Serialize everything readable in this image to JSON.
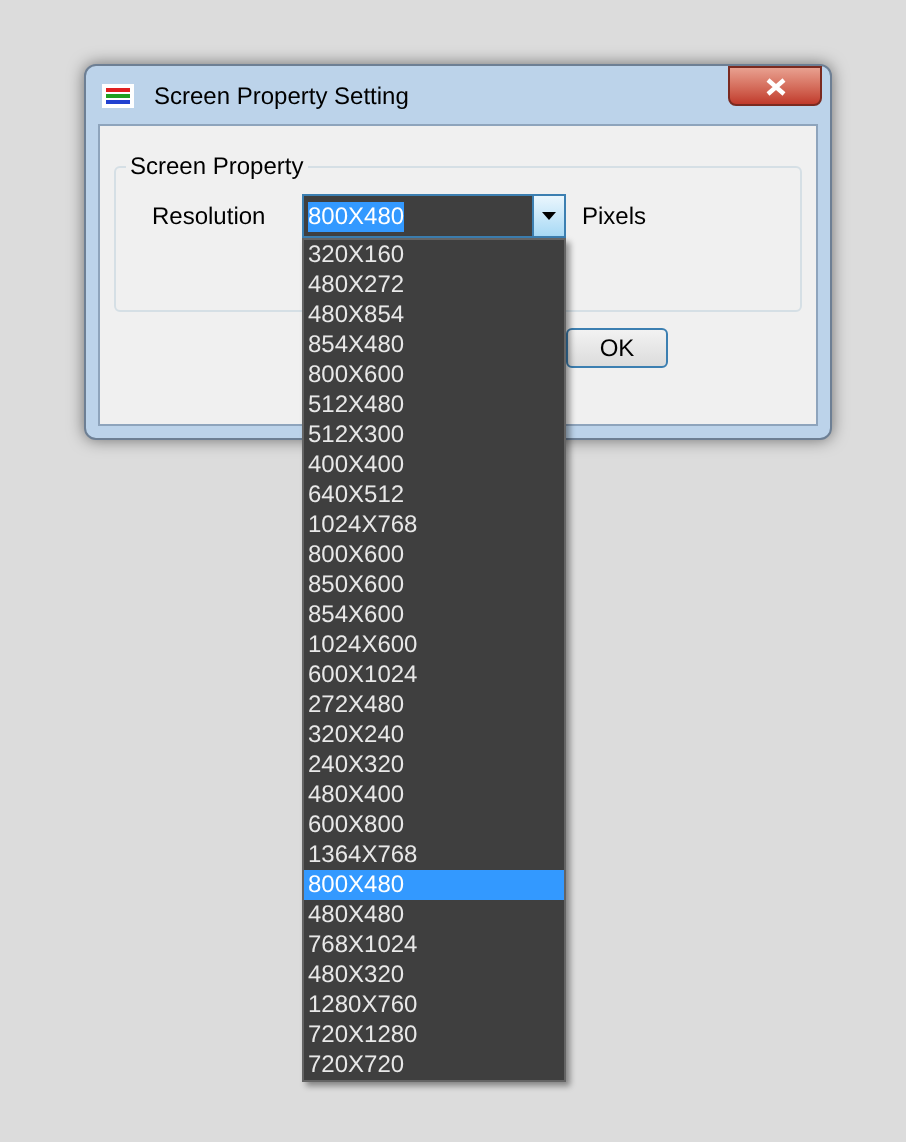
{
  "window": {
    "title": "Screen Property Setting"
  },
  "group": {
    "title": "Screen Property"
  },
  "resolution": {
    "label": "Resolution",
    "value": "800X480",
    "unit": "Pixels",
    "expanded": true,
    "options": [
      {
        "label": "320X160",
        "selected": false
      },
      {
        "label": "480X272",
        "selected": false
      },
      {
        "label": "480X854",
        "selected": false
      },
      {
        "label": "854X480",
        "selected": false
      },
      {
        "label": "800X600",
        "selected": false
      },
      {
        "label": "512X480",
        "selected": false
      },
      {
        "label": "512X300",
        "selected": false
      },
      {
        "label": "400X400",
        "selected": false
      },
      {
        "label": "640X512",
        "selected": false
      },
      {
        "label": "1024X768",
        "selected": false
      },
      {
        "label": "800X600",
        "selected": false
      },
      {
        "label": "850X600",
        "selected": false
      },
      {
        "label": "854X600",
        "selected": false
      },
      {
        "label": "1024X600",
        "selected": false
      },
      {
        "label": "600X1024",
        "selected": false
      },
      {
        "label": "272X480",
        "selected": false
      },
      {
        "label": "320X240",
        "selected": false
      },
      {
        "label": "240X320",
        "selected": false
      },
      {
        "label": "480X400",
        "selected": false
      },
      {
        "label": "600X800",
        "selected": false
      },
      {
        "label": "1364X768",
        "selected": false
      },
      {
        "label": "800X480",
        "selected": true
      },
      {
        "label": "480X480",
        "selected": false
      },
      {
        "label": "768X1024",
        "selected": false
      },
      {
        "label": "480X320",
        "selected": false
      },
      {
        "label": "1280X760",
        "selected": false
      },
      {
        "label": "720X1280",
        "selected": false
      },
      {
        "label": "720X720",
        "selected": false
      }
    ]
  },
  "buttons": [
    {
      "label": "OK"
    }
  ]
}
